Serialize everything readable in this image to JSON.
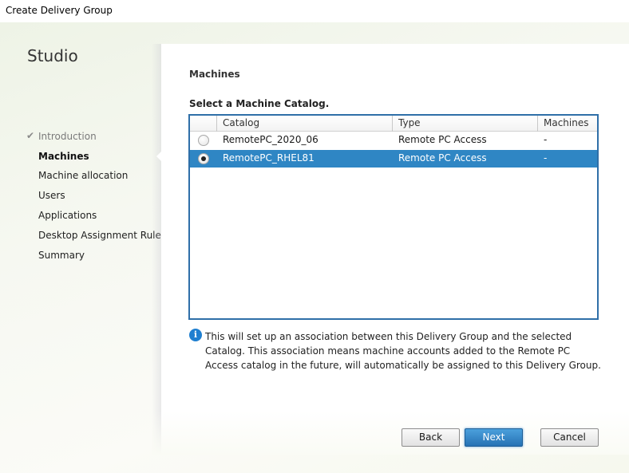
{
  "window": {
    "title": "Create Delivery Group"
  },
  "sidebar": {
    "app_title": "Studio",
    "steps": [
      {
        "label": "Introduction",
        "state": "done",
        "icon": "check-icon"
      },
      {
        "label": "Machines",
        "state": "current"
      },
      {
        "label": "Machine allocation",
        "state": "pending"
      },
      {
        "label": "Users",
        "state": "pending"
      },
      {
        "label": "Applications",
        "state": "pending"
      },
      {
        "label": "Desktop Assignment Rules",
        "state": "pending"
      },
      {
        "label": "Summary",
        "state": "pending"
      }
    ]
  },
  "main": {
    "section_title": "Machines",
    "prompt": "Select a Machine Catalog.",
    "table": {
      "columns": [
        "",
        "Catalog",
        "Type",
        "Machines"
      ],
      "rows": [
        {
          "selected": false,
          "catalog": "RemotePC_2020_06",
          "type": "Remote PC Access",
          "machines": "-"
        },
        {
          "selected": true,
          "catalog": "RemotePC_RHEL81",
          "type": "Remote PC Access",
          "machines": "-"
        }
      ]
    },
    "info": {
      "icon": "info-icon",
      "glyph": "i",
      "text": "This will set up an association between this Delivery Group and the selected Catalog. This association means machine accounts added to the Remote PC Access catalog in the future, will automatically be assigned to this Delivery Group."
    }
  },
  "footer": {
    "back_label": "Back",
    "next_label": "Next",
    "cancel_label": "Cancel"
  },
  "colors": {
    "selection": "#2f86c4",
    "grid_border": "#2f6fa8",
    "primary_button": "#2672b4",
    "info_icon": "#1f7fd0"
  }
}
